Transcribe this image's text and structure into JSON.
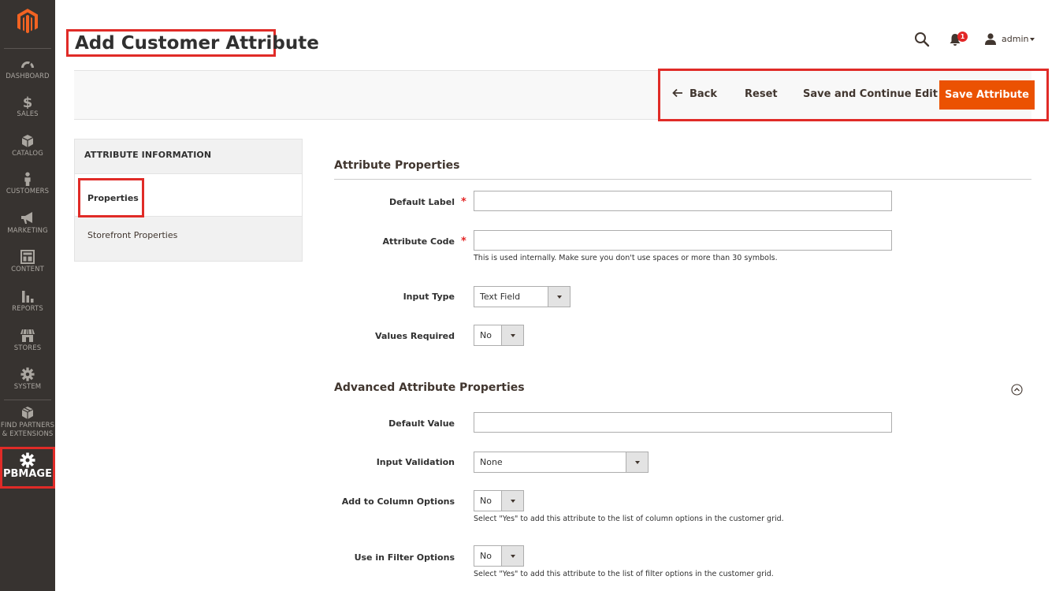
{
  "menu": {
    "items": [
      {
        "label": "DASHBOARD",
        "icon": "dashboard-icon"
      },
      {
        "label": "SALES",
        "icon": "dollar-icon"
      },
      {
        "label": "CATALOG",
        "icon": "cube-icon"
      },
      {
        "label": "CUSTOMERS",
        "icon": "person-icon"
      },
      {
        "label": "MARKETING",
        "icon": "megaphone-icon"
      },
      {
        "label": "CONTENT",
        "icon": "layout-icon"
      },
      {
        "label": "REPORTS",
        "icon": "bar-chart-icon"
      },
      {
        "label": "STORES",
        "icon": "storefront-icon"
      },
      {
        "label": "SYSTEM",
        "icon": "gear-icon"
      },
      {
        "label_line1": "FIND PARTNERS",
        "label_line2": "& EXTENSIONS",
        "icon": "box-icon"
      }
    ],
    "pbmage": {
      "label": "PBMAGE",
      "icon": "gear-icon"
    }
  },
  "header": {
    "title": "Add Customer Attribute",
    "notifications_count": "1",
    "user": "admin"
  },
  "actions": {
    "back": "Back",
    "reset": "Reset",
    "save_continue": "Save and Continue Edit",
    "save": "Save Attribute"
  },
  "tabs": {
    "title": "ATTRIBUTE INFORMATION",
    "items": [
      "Properties",
      "Storefront Properties"
    ]
  },
  "form": {
    "section1_title": "Attribute Properties",
    "default_label": {
      "label": "Default Label",
      "value": ""
    },
    "attribute_code": {
      "label": "Attribute Code",
      "value": "",
      "note": "This is used internally. Make sure you don't use spaces or more than 30 symbols."
    },
    "input_type": {
      "label": "Input Type",
      "value": "Text Field"
    },
    "values_required": {
      "label": "Values Required",
      "value": "No"
    },
    "section2_title": "Advanced Attribute Properties",
    "default_value": {
      "label": "Default Value",
      "value": ""
    },
    "input_validation": {
      "label": "Input Validation",
      "value": "None"
    },
    "add_column": {
      "label": "Add to Column Options",
      "value": "No",
      "note": "Select \"Yes\" to add this attribute to the list of column options in the customer grid."
    },
    "filter_options": {
      "label": "Use in Filter Options",
      "value": "No",
      "note": "Select \"Yes\" to add this attribute to the list of filter options in the customer grid."
    }
  },
  "colors": {
    "menu_bg": "#373330",
    "accent": "#eb5202",
    "highlight": "#e02b27"
  }
}
